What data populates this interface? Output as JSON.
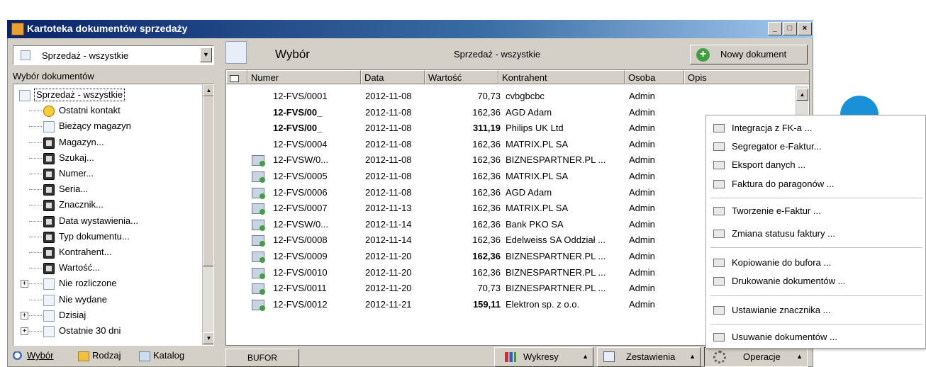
{
  "window": {
    "title": "Kartoteka dokumentów sprzedaży",
    "controls": [
      "_",
      "□",
      "×"
    ]
  },
  "left_panel": {
    "combo_value": "Sprzedaż - wszystkie",
    "section_label": "Wybór dokumentów",
    "tree": [
      {
        "label": "Sprzedaż - wszystkie",
        "icon": "document-icon"
      },
      {
        "label": "Ostatni kontakt",
        "icon": "clock-icon"
      },
      {
        "label": "Bieżący magazyn",
        "icon": "grid-icon"
      },
      {
        "label": "Magazyn...",
        "icon": "binoculars-icon"
      },
      {
        "label": "Szukaj...",
        "icon": "binoculars-icon"
      },
      {
        "label": "Numer...",
        "icon": "binoculars-icon"
      },
      {
        "label": "Seria...",
        "icon": "binoculars-icon"
      },
      {
        "label": "Znacznik...",
        "icon": "binoculars-icon"
      },
      {
        "label": "Data wystawienia...",
        "icon": "binoculars-icon"
      },
      {
        "label": "Typ dokumentu...",
        "icon": "binoculars-icon"
      },
      {
        "label": "Kontrahent...",
        "icon": "binoculars-icon"
      },
      {
        "label": "Wartość...",
        "icon": "binoculars-icon"
      },
      {
        "label": "Nie rozliczone",
        "icon": "grid-icon"
      },
      {
        "label": "Nie wydane",
        "icon": "grid-icon"
      },
      {
        "label": "Dzisiaj",
        "icon": "grid-icon"
      },
      {
        "label": "Ostatnie 30 dni",
        "icon": "grid-icon"
      }
    ],
    "tabs": [
      "Wybór",
      "Rodzaj",
      "Katalog"
    ]
  },
  "main": {
    "view_label": "Wybór",
    "filter_label": "Sprzedaż - wszystkie",
    "new_doc_button": "Nowy dokument",
    "columns": [
      "Numer",
      "Data",
      "Wartość",
      "Kontrahent",
      "Osoba",
      "Opis"
    ],
    "rows": [
      {
        "numer": "12-FVS/0001",
        "data": "2012-11-08",
        "wartosc": "70,73",
        "kontrahent": "cvbgbcbc",
        "osoba": "Admin",
        "icon": false,
        "bold": false
      },
      {
        "numer": "12-FVS/00_",
        "data": "2012-11-08",
        "wartosc": "162,36",
        "kontrahent": "AGD Adam",
        "osoba": "Admin",
        "icon": false,
        "bold": true
      },
      {
        "numer": "12-FVS/00_",
        "data": "2012-11-08",
        "wartosc": "311,19",
        "kontrahent": "Philips UK Ltd",
        "osoba": "Admin",
        "icon": false,
        "bold": true,
        "bold_value": true
      },
      {
        "numer": "12-FVS/0004",
        "data": "2012-11-08",
        "wartosc": "162,36",
        "kontrahent": "MATRIX.PL SA",
        "osoba": "Admin",
        "icon": false,
        "bold": false
      },
      {
        "numer": "12-FVSW/0...",
        "data": "2012-11-08",
        "wartosc": "162,36",
        "kontrahent": "BIZNESPARTNER.PL ...",
        "osoba": "Admin",
        "icon": true,
        "bold": false
      },
      {
        "numer": "12-FVS/0005",
        "data": "2012-11-08",
        "wartosc": "162,36",
        "kontrahent": "MATRIX.PL SA",
        "osoba": "Admin",
        "icon": true,
        "bold": false
      },
      {
        "numer": "12-FVS/0006",
        "data": "2012-11-08",
        "wartosc": "162,36",
        "kontrahent": "AGD Adam",
        "osoba": "Admin",
        "icon": true,
        "bold": false
      },
      {
        "numer": "12-FVS/0007",
        "data": "2012-11-13",
        "wartosc": "162,36",
        "kontrahent": "MATRIX.PL SA",
        "osoba": "Admin",
        "icon": true,
        "bold": false
      },
      {
        "numer": "12-FVSW/0...",
        "data": "2012-11-14",
        "wartosc": "162,36",
        "kontrahent": "Bank PKO SA",
        "osoba": "Admin",
        "icon": true,
        "bold": false
      },
      {
        "numer": "12-FVS/0008",
        "data": "2012-11-14",
        "wartosc": "162,36",
        "kontrahent": "Edelweiss SA Oddział ...",
        "osoba": "Admin",
        "icon": true,
        "bold": false
      },
      {
        "numer": "12-FVS/0009",
        "data": "2012-11-20",
        "wartosc": "162,36",
        "kontrahent": "BIZNESPARTNER.PL ...",
        "osoba": "Admin",
        "icon": true,
        "bold": false,
        "bold_value": true
      },
      {
        "numer": "12-FVS/0010",
        "data": "2012-11-20",
        "wartosc": "162,36",
        "kontrahent": "BIZNESPARTNER.PL ...",
        "osoba": "Admin",
        "icon": true,
        "bold": false
      },
      {
        "numer": "12-FVS/0011",
        "data": "2012-11-20",
        "wartosc": "70,73",
        "kontrahent": "BIZNESPARTNER.PL ...",
        "osoba": "Admin",
        "icon": true,
        "bold": false
      },
      {
        "numer": "12-FVS/0012",
        "data": "2012-11-21",
        "wartosc": "159,11",
        "kontrahent": "Elektron sp. z o.o.",
        "osoba": "Admin",
        "icon": true,
        "bold": false,
        "bold_value": true
      }
    ],
    "bottom": {
      "bufor": "BUFOR",
      "wykresy": "Wykresy",
      "zestawienia": "Zestawienia",
      "operacje": "Operacje"
    }
  },
  "menu": {
    "items": [
      "Integracja z FK-a ...",
      "Segregator e-Faktur...",
      "Eksport danych ...",
      "Faktura do paragonów ...",
      "Tworzenie e-Faktur ...",
      "Zmiana statusu faktury ...",
      "Kopiowanie do bufora ...",
      "Drukowanie dokumentów ...",
      "Ustawianie znacznika ...",
      "Usuwanie dokumentów ..."
    ]
  },
  "colors": {
    "title_start": "#0a246a",
    "title_end": "#a6caf0",
    "face": "#d4d0c8",
    "accent_circle": "#1a90d8"
  }
}
